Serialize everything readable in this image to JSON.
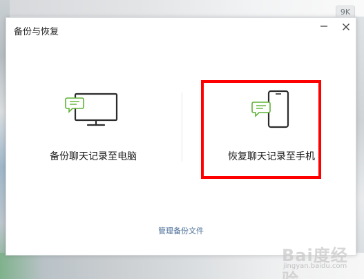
{
  "background": {
    "badge": "9K"
  },
  "dialog": {
    "title": "备份与恢复",
    "minimize_icon": "minimize-icon",
    "close_icon": "close-icon",
    "options": [
      {
        "label": "备份聊天记录至电脑",
        "icon": "monitor-chat-icon"
      },
      {
        "label": "恢复聊天记录至手机",
        "icon": "phone-chat-icon"
      }
    ],
    "manage_link": "管理备份文件"
  },
  "accent_colors": {
    "highlight": "#ff0000",
    "chat_green": "#5fb336",
    "link": "#4b6e98"
  },
  "watermark": {
    "logo": "Bai度经验",
    "sub": "jingyan.baidu.com"
  }
}
